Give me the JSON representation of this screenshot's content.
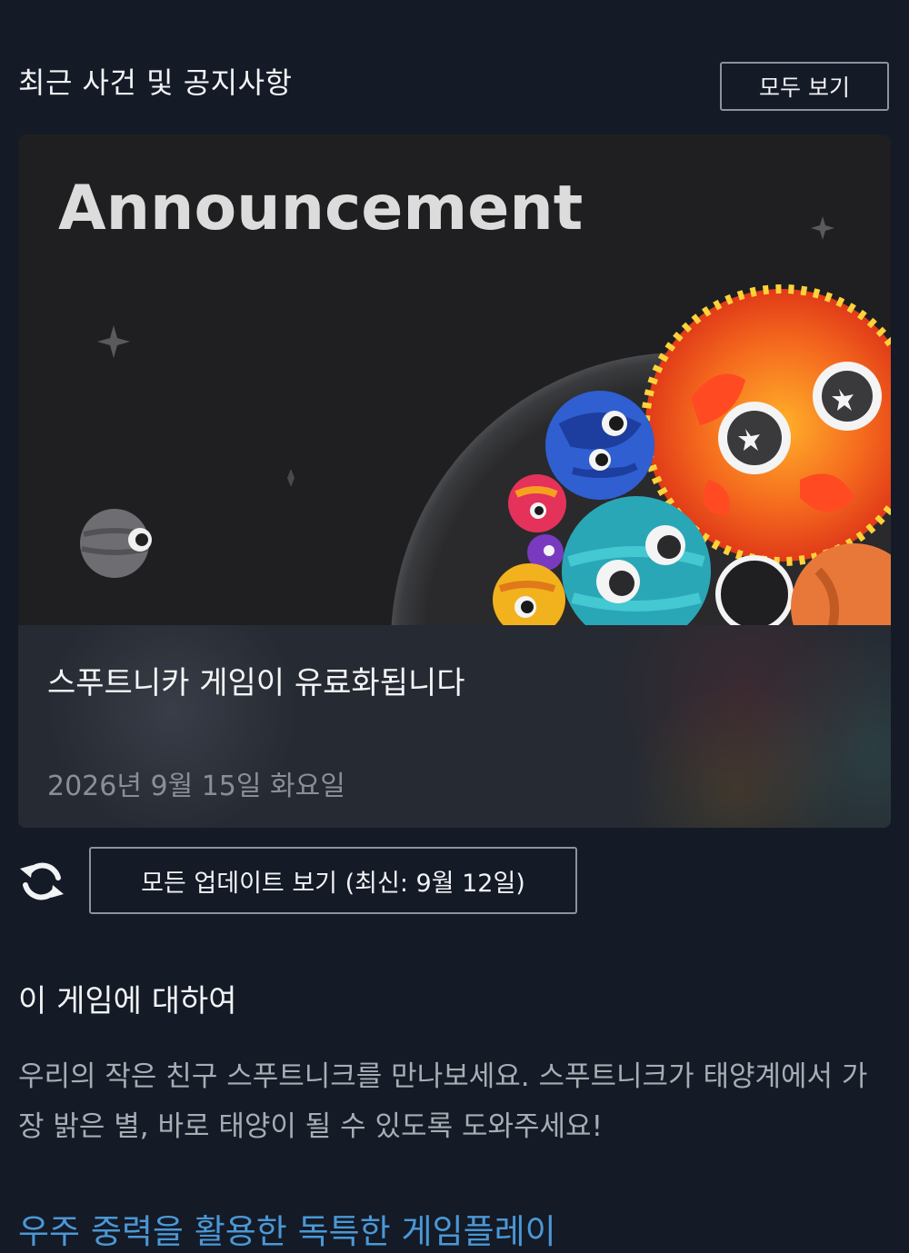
{
  "header": {
    "title": "최근 사건 및 공지사항",
    "view_all_label": "모두 보기"
  },
  "announcement": {
    "banner_text": "Announcement",
    "title": "스푸트니카 게임이 유료화됩니다",
    "date": "2026년 9월 15일 화요일"
  },
  "updates": {
    "refresh_icon": "refresh-icon",
    "button_label": "모든 업데이트 보기 (최신: 9월 12일)"
  },
  "about": {
    "title": "이 게임에 대하여",
    "description": "우리의 작은 친구 스푸트니크를 만나보세요. 스푸트니크가 태양계에서 가장 밝은 별, 바로 태양이 될 수 있도록 도와주세요!",
    "section_link": "우주 중력을 활용한 독특한 게임플레이"
  },
  "colors": {
    "background": "#141a26",
    "card": "#262a32",
    "link": "#4a98d6"
  }
}
